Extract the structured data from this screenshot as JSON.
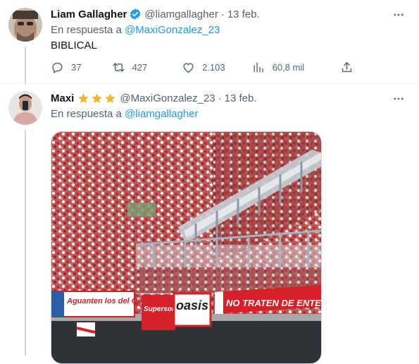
{
  "tweet1": {
    "name": "Liam Gallagher",
    "handle": "@liamgallagher",
    "separator": "·",
    "date": "13 feb.",
    "reply_prefix": "En respuesta a",
    "reply_mention": "@MaxiGonzalez_23",
    "text": "BIBLICAL",
    "actions": {
      "replies": "37",
      "retweets": "427",
      "likes": "2.103",
      "views": "60,8 mil"
    }
  },
  "tweet2": {
    "name": "Maxi",
    "stars": 3,
    "handle": "@MaxiGonzalez_23",
    "separator": "·",
    "date": "13 feb.",
    "reply_prefix": "En respuesta a",
    "reply_mention": "@liamgallagher",
    "banners": {
      "left": "Aguanten los del Oeste",
      "center": "oasis",
      "center_left": "Supersonic",
      "right": "NO TRATEN DE ENTENDERNOS"
    }
  },
  "colors": {
    "accent": "#1d9bf0",
    "secondary_text": "#536471",
    "verified": "#1d9bf0",
    "star": "#f4b52a",
    "banner_red": "#d7202a"
  },
  "icons": [
    "more-icon",
    "verified-badge-icon",
    "reply-icon",
    "retweet-icon",
    "like-icon",
    "views-icon",
    "share-icon",
    "star-icon"
  ]
}
